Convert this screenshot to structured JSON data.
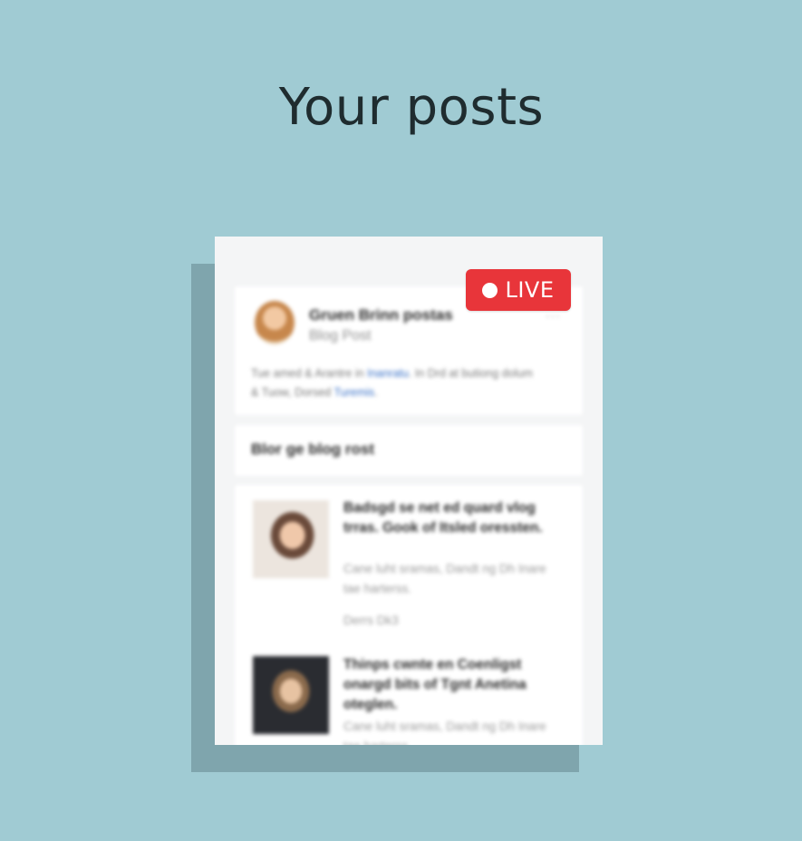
{
  "page": {
    "title": "Your posts"
  },
  "live_badge": {
    "label": "LIVE"
  },
  "author_card": {
    "name": "Gruen Brinn postas",
    "subtitle": "Blog Post",
    "more_label": "···",
    "desc_before": "Tue amed & Arantre in",
    "desc_link_1": "Inanratu",
    "desc_middle": ". In Drd at butiong dolum & Tuow, Dorsed",
    "desc_link_2": "Turemis",
    "desc_after": "."
  },
  "section": {
    "heading": "Blor ge blog rost"
  },
  "posts": [
    {
      "title": "Badsgd se net ed quard vlog trras. Gook of Itsled oressten.",
      "excerpt": "Cane luht sramas, Dandt ng Dh Inare tae harterss.",
      "meta": "Derrs Dk3"
    },
    {
      "title": "Thinps cwnte en Coenligst onargd bits of Tgnt Anetina oteglen.",
      "excerpt": "Cane luht sramas, Dandt ng Dh Inare tae harterss."
    }
  ],
  "colors": {
    "background": "#a0cbd3",
    "shadow": "#7fa5ad",
    "live_red": "#e8353a",
    "link_blue": "#3b72c7"
  }
}
